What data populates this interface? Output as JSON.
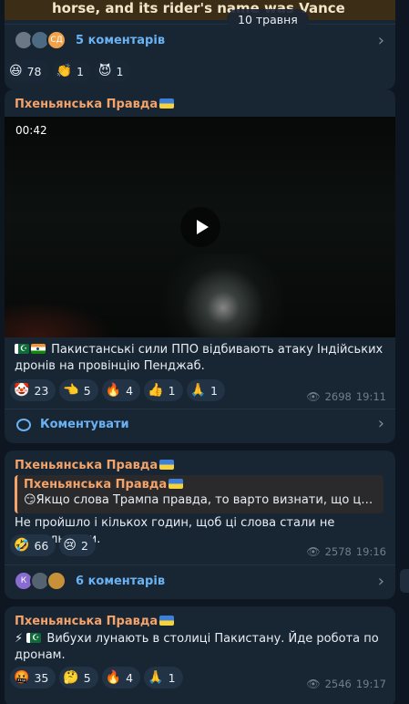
{
  "top_post": {
    "video_caption": "horse, and its rider's name was Vance",
    "date_badge": "10 травня",
    "comments": {
      "label": "5 коментарів",
      "avatars": [
        "",
        "",
        "СД"
      ]
    },
    "reactions": [
      {
        "icon": "grinning-face",
        "emoji": "😆",
        "count": "78"
      },
      {
        "icon": "clapping-hands",
        "emoji": "👏",
        "count": "1"
      },
      {
        "icon": "smiling-devil",
        "emoji": "😈",
        "count": "1"
      }
    ]
  },
  "post1": {
    "author": "Пхеньянська Правда",
    "video_duration": "00:42",
    "text": "Пакистанські сили ППО відбивають атаку Індійських дронів на провінцію Пенджаб.",
    "reactions": [
      {
        "icon": "clown-face",
        "emoji": "🤡",
        "count": "23"
      },
      {
        "icon": "point-left",
        "emoji": "👈",
        "count": "5"
      },
      {
        "icon": "fire",
        "emoji": "🔥",
        "count": "4"
      },
      {
        "icon": "thumbs-up",
        "emoji": "👍",
        "count": "1"
      },
      {
        "icon": "folded-hands",
        "emoji": "🙏",
        "count": "1"
      }
    ],
    "views": "2698",
    "time": "19:11",
    "comment_button": "Коментувати"
  },
  "post2": {
    "author": "Пхеньянська Правда",
    "quote_author": "Пхеньянська Правда",
    "quote_text": "Якщо слова Трампа правда, то варто визнати, що це реал...",
    "text": "Не пройшло і кількох годин, щоб ці слова стали не актуальними.",
    "reactions": [
      {
        "icon": "rofl-face",
        "emoji": "🤣",
        "count": "66"
      },
      {
        "icon": "crying-face",
        "emoji": "😢",
        "count": "2"
      }
    ],
    "views": "2578",
    "time": "19:16",
    "comments": {
      "label": "6 коментарів",
      "avatars": [
        "К",
        "",
        ""
      ]
    }
  },
  "post3": {
    "author": "Пхеньянська Правда",
    "text": "Вибухи лунають в столиці Пакистану. Йде робота по дронам.",
    "reactions": [
      {
        "icon": "angry-face",
        "emoji": "🤬",
        "count": "35"
      },
      {
        "icon": "thinking-face",
        "emoji": "🤔",
        "count": "5"
      },
      {
        "icon": "fire",
        "emoji": "🔥",
        "count": "4"
      },
      {
        "icon": "folded-hands",
        "emoji": "🙏",
        "count": "1"
      }
    ],
    "views": "2546",
    "time": "19:17"
  }
}
